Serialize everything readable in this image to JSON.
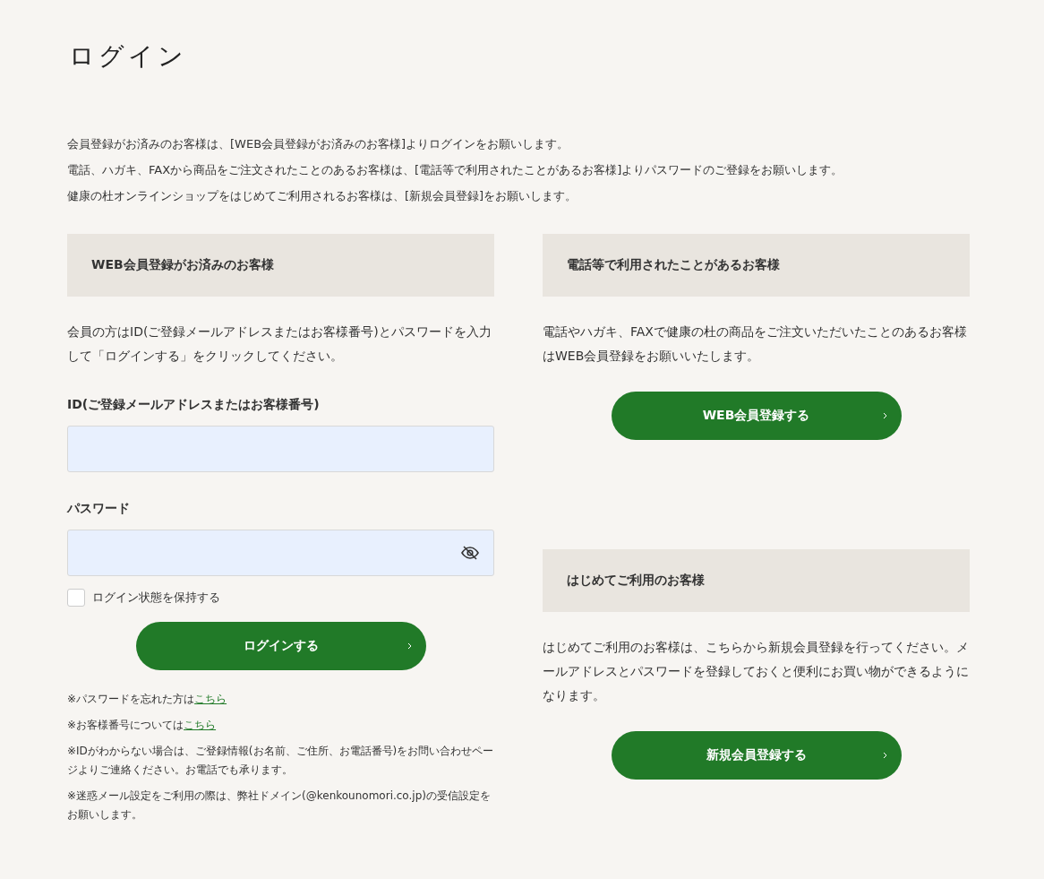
{
  "title": "ログイン",
  "intro": [
    "会員登録がお済みのお客様は、[WEB会員登録がお済みのお客様]よりログインをお願いします。",
    "電話、ハガキ、FAXから商品をご注文されたことのあるお客様は、[電話等で利用されたことがあるお客様]よりパスワードのご登録をお願いします。",
    "健康の杜オンラインショップをはじめてご利用されるお客様は、[新規会員登録]をお願いします。"
  ],
  "login": {
    "heading": "WEB会員登録がお済みのお客様",
    "description": "会員の方はID(ご登録メールアドレスまたはお客様番号)とパスワードを入力して「ログインする」をクリックしてください。",
    "fields": [
      {
        "label": "ID(ご登録メールアドレスまたはお客様番号)",
        "kind": "text"
      },
      {
        "label": "パスワード",
        "kind": "password"
      }
    ],
    "remember": {
      "label": "ログイン状態を保持する",
      "checked": false
    },
    "button": "ログインする",
    "notes": [
      {
        "text": "※パスワードを忘れた方は",
        "link": "こちら"
      },
      {
        "text": "※お客様番号については",
        "link": "こちら"
      },
      {
        "text": "※IDがわからない場合は、ご登録情報(お名前、ご住所、お電話番号)をお問い合わせページよりご連絡ください。お電話でも承ります。"
      },
      {
        "text": "※迷惑メール設定をご利用の際は、弊社ドメイン(@kenkounomori.co.jp)の受信設定をお願いします。"
      }
    ]
  },
  "sections": [
    {
      "heading": "電話等で利用されたことがあるお客様",
      "description": "電話やハガキ、FAXで健康の杜の商品をご注文いただいたことのあるお客様はWEB会員登録をお願いいたします。",
      "button": "WEB会員登録する"
    },
    {
      "heading": "はじめてご利用のお客様",
      "description": "はじめてご利用のお客様は、こちらから新規会員登録を行ってください。メールアドレスとパスワードを登録しておくと便利にお買い物ができるようになります。",
      "button": "新規会員登録する"
    }
  ]
}
